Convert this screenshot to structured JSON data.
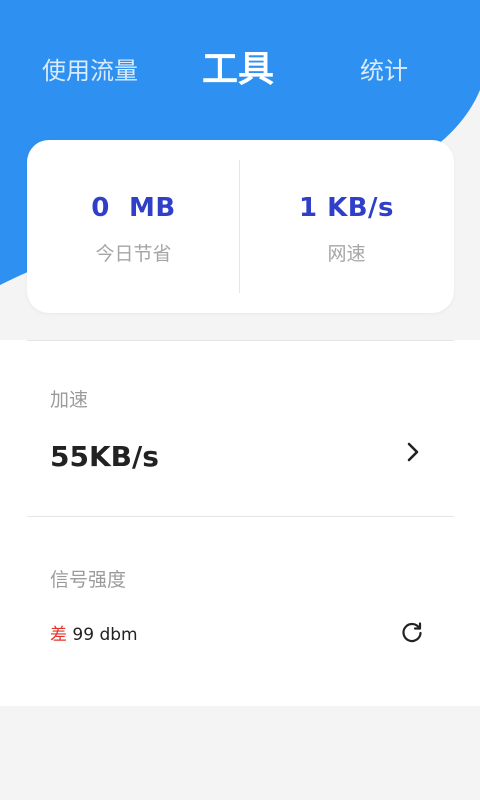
{
  "tabs": [
    {
      "label": "使用流量"
    },
    {
      "label": "工具"
    },
    {
      "label": "统计"
    }
  ],
  "stats": {
    "saved_value": "0  MB",
    "saved_label": "今日节省",
    "net_speed_value": "1 KB/s",
    "net_speed_label": "网速"
  },
  "accelerate": {
    "label": "加速",
    "value": "55KB/s",
    "icon": "chevron-right-icon"
  },
  "signal": {
    "label": "信号强度",
    "quality": "差",
    "value": "99 dbm",
    "icon": "refresh-icon"
  },
  "colors": {
    "header_blue": "#2e91f1",
    "accent_text": "#2f3fc7",
    "signal_bad": "#e5352b"
  }
}
